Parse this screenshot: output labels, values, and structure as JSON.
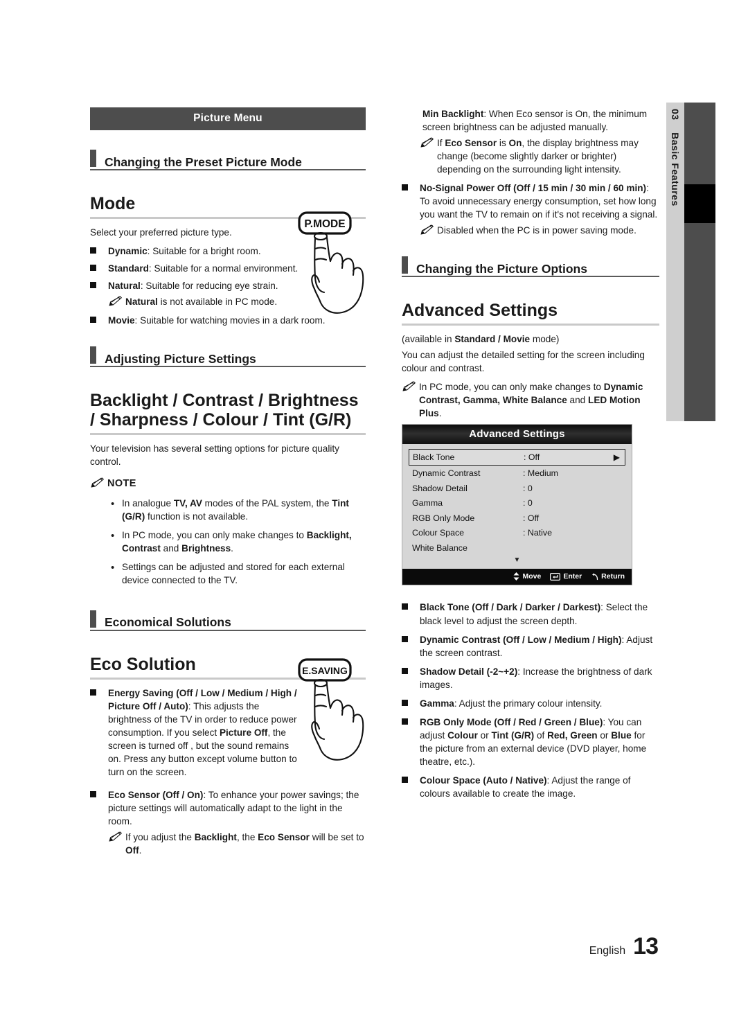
{
  "page": {
    "language": "English",
    "number": "13"
  },
  "chapter_tab": {
    "number": "03",
    "title": "Basic Features"
  },
  "left_column": {
    "menu_banner": "Picture Menu",
    "section1": {
      "subhead": "Changing the Preset Picture Mode",
      "item_heading": "Mode",
      "intro": "Select your preferred picture type.",
      "bullets": [
        {
          "term": "Dynamic",
          "rest": ": Suitable for a bright room."
        },
        {
          "term": "Standard",
          "rest": ": Suitable for a normal environment."
        },
        {
          "term": "Natural",
          "rest": ": Suitable for reducing eye strain."
        },
        {
          "term": "Movie",
          "rest": ": Suitable for watching movies in a dark room."
        }
      ],
      "natural_note_pre": "",
      "natural_note_bold": "Natural",
      "natural_note_post": " is not available in PC mode."
    },
    "section2": {
      "subhead": "Adjusting Picture Settings",
      "item_heading": "Backlight / Contrast / Brightness / Sharpness / Colour / Tint (G/R)",
      "intro": "Your television has several setting options for picture quality control.",
      "note_title": "NOTE",
      "notes": [
        "In analogue TV, AV modes of the PAL system, the Tint (G/R) function is not available.",
        "In PC mode, you can only make changes to Backlight, Contrast and Brightness.",
        "Settings can be adjusted and stored for each external device connected to the TV."
      ]
    },
    "section3": {
      "subhead": "Economical Solutions",
      "item_heading": "Eco Solution",
      "bullets": [
        {
          "term": "Energy Saving (Off / Low / Medium / High / Picture Off  / Auto)",
          "rest": ": This adjusts the brightness of the TV in order to reduce power consumption. If you select Picture Off, the screen is turned off , but the sound remains on. Press any button except volume button to turn on the screen."
        },
        {
          "term": "Eco Sensor (Off / On)",
          "rest": ": To enhance your power savings; the picture settings will automatically adapt to the light in the room."
        }
      ],
      "eco_note": "If you adjust the Backlight, the Eco Sensor will be set to Off."
    },
    "remote_keys": [
      {
        "label": "P.MODE"
      },
      {
        "label": "E.SAVING"
      }
    ]
  },
  "right_column": {
    "top_bullets": [
      {
        "term": "Min Backlight",
        "rest": ": When Eco sensor is On, the minimum screen brightness can be adjusted manually.",
        "note": "If Eco Sensor is On, the display brightness may change (become slightly darker or brighter) depending on the surrounding light intensity."
      },
      {
        "term": "No-Signal Power Off (Off / 15 min / 30 min / 60 min)",
        "rest": ": To avoid unnecessary energy consumption, set how long you want the TV to remain on if it's not receiving a signal.",
        "note": "Disabled when the PC is in power saving mode."
      }
    ],
    "section": {
      "subhead": "Changing the Picture Options",
      "item_heading": "Advanced Settings",
      "availability": "(available in Standard / Movie mode)",
      "intro": "You can adjust the detailed setting for the screen including colour and contrast.",
      "note": "In PC mode, you can only make changes to Dynamic Contrast, Gamma, White Balance and LED Motion Plus."
    },
    "osd": {
      "title": "Advanced Settings",
      "rows": [
        {
          "label": "Black Tone",
          "value": ": Off",
          "selected": true,
          "arrow": "▶"
        },
        {
          "label": "Dynamic Contrast",
          "value": ": Medium",
          "selected": false,
          "arrow": ""
        },
        {
          "label": "Shadow Detail",
          "value": ": 0",
          "selected": false,
          "arrow": ""
        },
        {
          "label": "Gamma",
          "value": ": 0",
          "selected": false,
          "arrow": ""
        },
        {
          "label": "RGB Only Mode",
          "value": ": Off",
          "selected": false,
          "arrow": ""
        },
        {
          "label": "Colour Space",
          "value": ": Native",
          "selected": false,
          "arrow": ""
        },
        {
          "label": "White Balance",
          "value": "",
          "selected": false,
          "arrow": ""
        }
      ],
      "scroll_indicator": "▼",
      "footer": [
        {
          "icon": "up-down-arrow-icon",
          "label": "Move"
        },
        {
          "icon": "enter-key-icon",
          "label": "Enter"
        },
        {
          "icon": "return-arrow-icon",
          "label": "Return"
        }
      ]
    },
    "bottom_bullets": [
      {
        "term": "Black Tone (Off / Dark / Darker / Darkest)",
        "rest": ": Select the black level to adjust the screen depth."
      },
      {
        "term": "Dynamic Contrast (Off / Low / Medium / High)",
        "rest": ": Adjust the screen contrast."
      },
      {
        "term": "Shadow Detail (-2~+2)",
        "rest": ": Increase the brightness of dark images."
      },
      {
        "term": "Gamma",
        "rest": ": Adjust the primary colour intensity."
      },
      {
        "term": "RGB Only Mode (Off / Red / Green / Blue)",
        "rest": ": You can adjust Colour or Tint (G/R) of Red, Green or Blue for the picture from an external device (DVD player, home theatre, etc.)."
      },
      {
        "term": "Colour Space (Auto / Native)",
        "rest": ": Adjust the range of colours available to create the image."
      }
    ]
  }
}
